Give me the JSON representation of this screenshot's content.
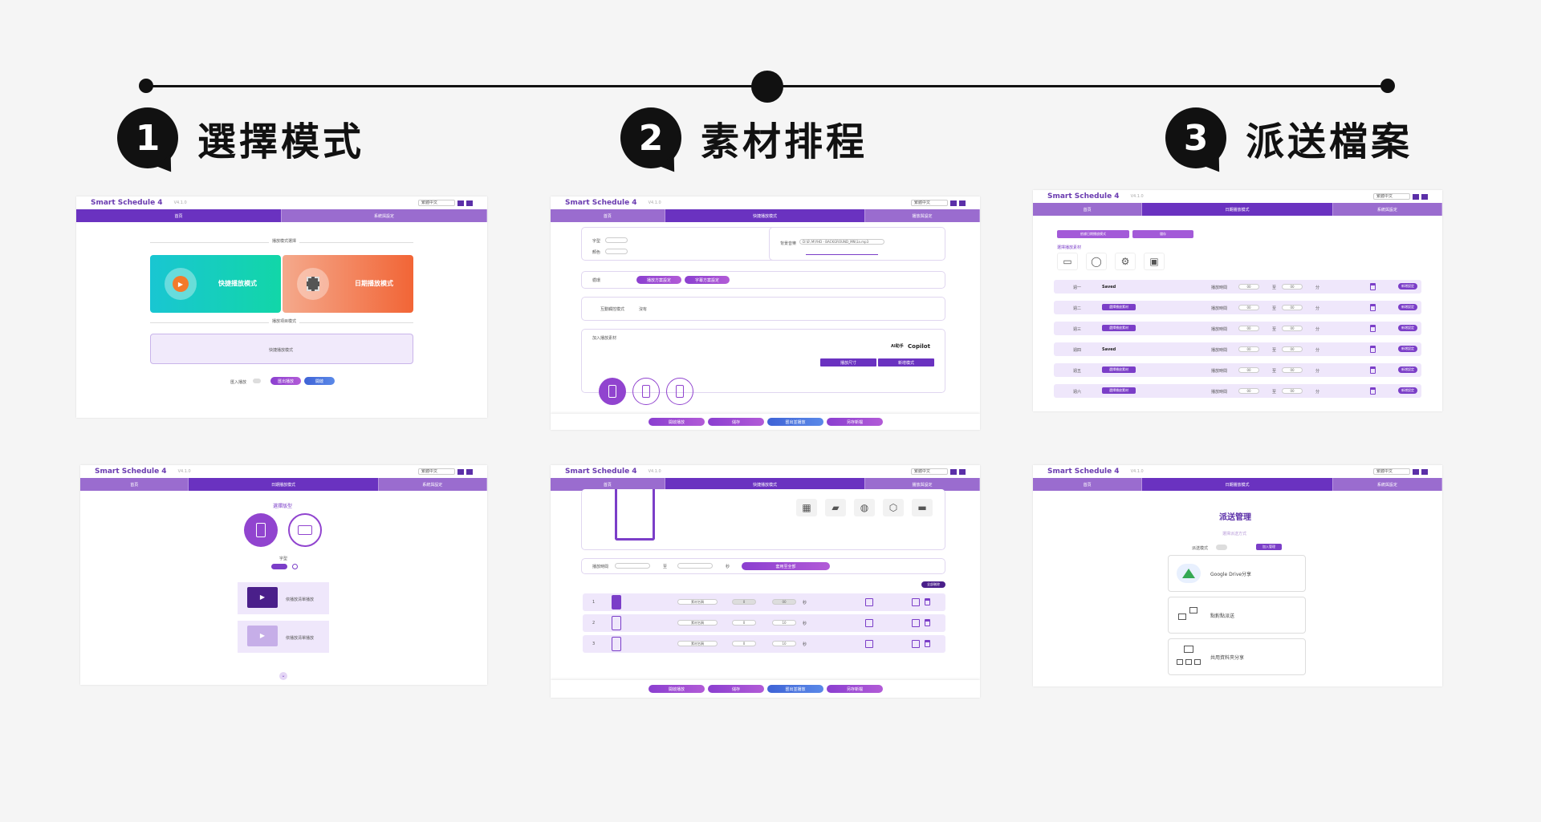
{
  "timeline": {
    "steps": [
      {
        "num": "1",
        "title": "選擇模式"
      },
      {
        "num": "2",
        "title": "素材排程"
      },
      {
        "num": "3",
        "title": "派送檔案"
      }
    ]
  },
  "app": {
    "logo": "Smart Schedule 4",
    "version": "V4.1.0",
    "language": "繁體中文"
  },
  "shot1": {
    "nav": [
      "首頁",
      "系統與設定"
    ],
    "section1": "播放模式選擇",
    "quick_mode": "快捷播放模式",
    "daily_mode": "日期播放模式",
    "section2": "播放項目模式",
    "placeholder": "快捷播放模式",
    "import_label": "匯入播放",
    "btn_import": "匯出播放",
    "btn_next": "開啟"
  },
  "shot2": {
    "nav": [
      "首頁",
      "快捷播放模式",
      "播放與設定"
    ],
    "label_font": "字型",
    "label_color": "顏色",
    "label_loop": "循環",
    "bgm_label": "背景音樂",
    "bgm_file": "D:\\E\\ M\\YHD - BACKGROUND_MN\\1a.mp3",
    "btn_schedule1": "播放方案設定",
    "btn_schedule2": "字幕方案設定",
    "touch_label": "互動觸控模式",
    "touch_value": "沒有",
    "section_media": "加入播放素材",
    "ai_label": "AI助手",
    "copilot": "Copilot",
    "btn_media1": "播放尺寸",
    "btn_media2": "新增模式",
    "footer": [
      "開啟播放",
      "儲存",
      "匯出並播放",
      "另存新檔"
    ]
  },
  "shot3": {
    "nav": [
      "首頁",
      "日期播放模式",
      "系統與設定"
    ],
    "tab1": "依據日期播放模式",
    "tab2": "儲存",
    "icons_label": "選擇播放素材",
    "rows": [
      {
        "day": "週一",
        "mode": "Saved",
        "time_label": "播放時間",
        "h": "00",
        "m": "00",
        "btn": "新增設定"
      },
      {
        "day": "週二",
        "mode": "選擇播放素材",
        "time_label": "播放時間",
        "h": "00",
        "m": "00",
        "btn": "新增設定"
      },
      {
        "day": "週三",
        "mode": "選擇播放素材",
        "time_label": "播放時間",
        "h": "00",
        "m": "00",
        "btn": "新增設定"
      },
      {
        "day": "週四",
        "mode": "Saved",
        "time_label": "播放時間",
        "h": "00",
        "m": "00",
        "btn": "新增設定"
      },
      {
        "day": "週五",
        "mode": "選擇播放素材",
        "time_label": "播放時間",
        "h": "00",
        "m": "00",
        "btn": "新增設定"
      },
      {
        "day": "週六",
        "mode": "選擇播放素材",
        "time_label": "播放時間",
        "h": "00",
        "m": "00",
        "btn": "新增設定"
      }
    ],
    "sep": "至",
    "unit": "分"
  },
  "shot4": {
    "nav": [
      "首頁",
      "日期播放模式",
      "系統與設定"
    ],
    "heading": "選擇版型",
    "label_font": "字型",
    "card1": "依播放清單播放",
    "card2": "依播放清單播放"
  },
  "shot5": {
    "nav": [
      "首頁",
      "快捷播放模式",
      "播放與設定"
    ],
    "time_label": "播放時間",
    "sep": "至",
    "unit": "秒",
    "btn_apply": "套用至全部",
    "add_btn": "全部刪除",
    "rows": [
      {
        "n": "1",
        "name": "素材名稱",
        "a": "0",
        "b": "00"
      },
      {
        "n": "2",
        "name": "素材名稱",
        "a": "0",
        "b": "10"
      },
      {
        "n": "3",
        "name": "素材名稱",
        "a": "0",
        "b": "10"
      }
    ],
    "row_unit": "秒",
    "footer": [
      "開啟播放",
      "儲存",
      "匯出並播放",
      "另存新檔"
    ]
  },
  "shot6": {
    "nav": [
      "首頁",
      "日期播放模式",
      "系統與設定"
    ],
    "heading": "派送管理",
    "subheading": "選擇派送方式",
    "toggle_label": "派送模式",
    "toggle_btn": "加入管理",
    "methods": [
      "Google Drive分享",
      "點對點派送",
      "共用資料夾分享"
    ]
  },
  "colors": {
    "accent": "#6a32c0",
    "light_accent": "#9a6ccf",
    "row_bg": "#efe7fb",
    "quick": "#16c9c0",
    "daily": "#f06a3a"
  }
}
